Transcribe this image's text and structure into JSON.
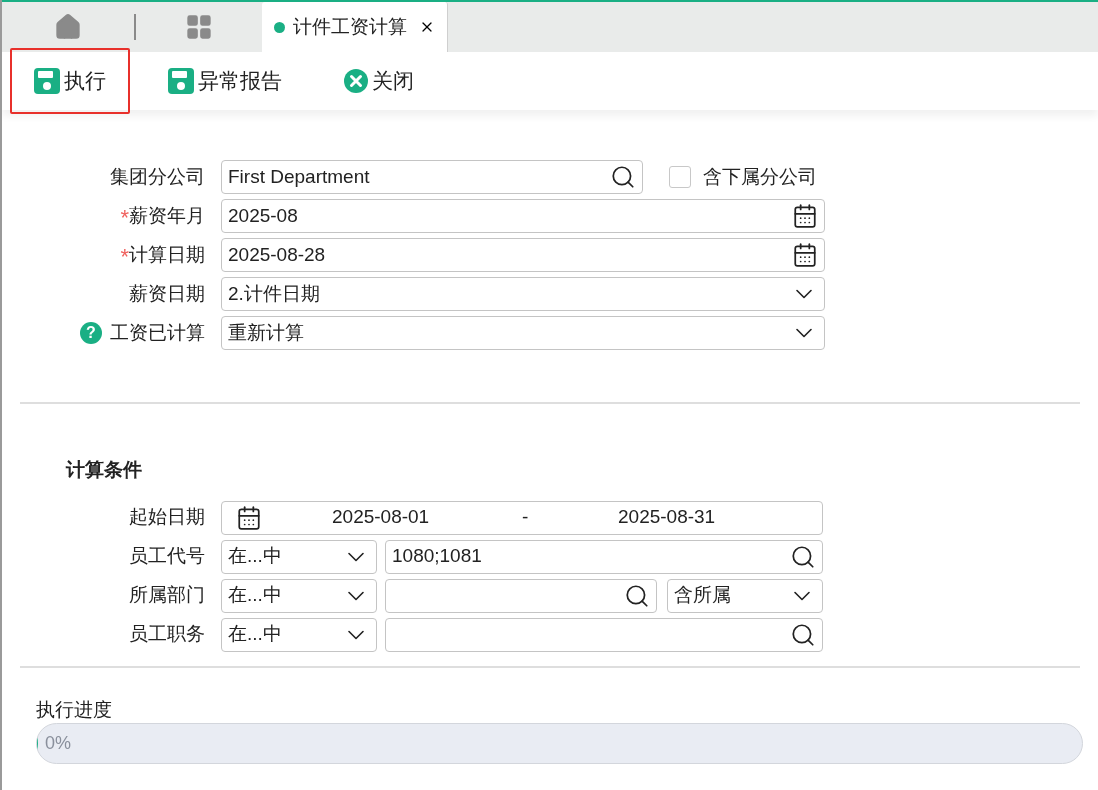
{
  "tab_bar": {
    "tabs": [
      {
        "label": "计件工资计算",
        "selected": true
      }
    ]
  },
  "toolbar": {
    "buttons": [
      {
        "label": "执行",
        "kind": "save",
        "highlighted": true
      },
      {
        "label": "异常报告",
        "kind": "save",
        "highlighted": false
      },
      {
        "label": "关闭",
        "kind": "close",
        "highlighted": false
      }
    ]
  },
  "form": {
    "fields": [
      {
        "label": "集团分公司",
        "kind": "lookup",
        "value": "First Department",
        "checkbox": {
          "label": "含下属分公司",
          "checked": false
        }
      },
      {
        "label": "薪资年月",
        "kind": "date",
        "value": "2025-08",
        "marker": {
          "kind": "required",
          "text": "*"
        }
      },
      {
        "label": "计算日期",
        "kind": "date",
        "value": "2025-08-28",
        "marker": {
          "kind": "required",
          "text": "*"
        }
      },
      {
        "label": "薪资日期",
        "kind": "select",
        "value": "2.计件日期"
      },
      {
        "label": "工资已计算",
        "kind": "select",
        "value": "重新计算",
        "marker": {
          "kind": "help",
          "text": "?"
        }
      }
    ]
  },
  "conditions": {
    "title": "计算条件",
    "rows": [
      {
        "label": "起始日期",
        "kind": "date_range",
        "from": "2025-08-01",
        "separator": "-",
        "to": "2025-08-31"
      },
      {
        "label": "员工代号",
        "kind": "filter",
        "operator": "在...中",
        "value": "1080;1081"
      },
      {
        "label": "所属部门",
        "kind": "filter",
        "operator": "在...中",
        "value": "",
        "extra": "含所属"
      },
      {
        "label": "员工职务",
        "kind": "filter",
        "operator": "在...中",
        "value": ""
      }
    ]
  },
  "progress": {
    "label": "执行进度",
    "level": 0,
    "reading": "0%"
  }
}
